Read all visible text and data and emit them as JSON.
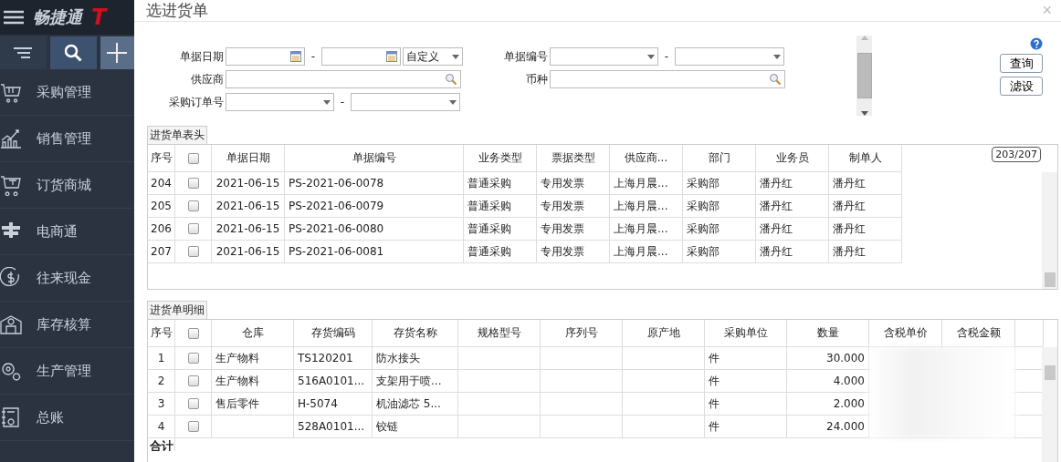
{
  "sidebar": {
    "logo": "畅捷通",
    "logo_mark": "T",
    "items": [
      {
        "label": "采购管理",
        "kind": "basket"
      },
      {
        "label": "销售管理",
        "kind": "chart"
      },
      {
        "label": "订货商城",
        "kind": "cart"
      },
      {
        "label": "电商通",
        "kind": "glyph"
      },
      {
        "label": "往来现金",
        "kind": "dollar"
      },
      {
        "label": "库存核算",
        "kind": "warehouse"
      },
      {
        "label": "生产管理",
        "kind": "gears"
      },
      {
        "label": "总账",
        "kind": "ledger"
      }
    ]
  },
  "dialog": {
    "title": "选进货单",
    "close": "×",
    "filters": {
      "date_label": "单据日期",
      "dash1": "-",
      "period": "自定义",
      "supplier_label": "供应商",
      "po_label": "采购订单号",
      "dash2": "-",
      "number_label": "单据编号",
      "dash3": "-",
      "currency_label": "币种"
    },
    "buttons": [
      "查询",
      "滤设"
    ],
    "header_table": {
      "tab": "进货单表头",
      "counter": "203/207",
      "select_all_checked": false,
      "columns": [
        "序号",
        "",
        "单据日期",
        "单据编号",
        "业务类型",
        "票据类型",
        "供应商...",
        "部门",
        "业务员",
        "制单人"
      ],
      "rows": [
        {
          "cells": [
            "204",
            "",
            "2021-06-15",
            "PS-2021-06-0078",
            "普通采购",
            "专用发票",
            "上海月晨...",
            "采购部",
            "潘丹红",
            "潘丹红"
          ],
          "checked": false
        },
        {
          "cells": [
            "205",
            "",
            "2021-06-15",
            "PS-2021-06-0079",
            "普通采购",
            "专用发票",
            "上海月晨...",
            "采购部",
            "潘丹红",
            "潘丹红"
          ],
          "checked": false
        },
        {
          "cells": [
            "206",
            "",
            "2021-06-15",
            "PS-2021-06-0080",
            "普通采购",
            "专用发票",
            "上海月晨...",
            "采购部",
            "潘丹红",
            "潘丹红"
          ],
          "checked": false
        },
        {
          "cells": [
            "207",
            "",
            "2021-06-15",
            "PS-2021-06-0081",
            "普通采购",
            "专用发票",
            "上海月晨...",
            "采购部",
            "潘丹红",
            "潘丹红"
          ],
          "checked": false
        }
      ]
    },
    "detail_table": {
      "tab": "进货单明细",
      "footer": "合计",
      "select_all_checked": false,
      "columns": [
        "序号",
        "",
        "仓库",
        "存货编码",
        "存货名称",
        "规格型号",
        "序列号",
        "原产地",
        "采购单位",
        "数量",
        "含税单价",
        "含税金额",
        ""
      ],
      "rows": [
        {
          "cells": [
            "1",
            "",
            "生产物料",
            "TS120201",
            "防水接头",
            "",
            "",
            "",
            "件",
            "30.000",
            "",
            ""
          ],
          "checked": false
        },
        {
          "cells": [
            "2",
            "",
            "生产物料",
            "516A0101...",
            "支架用于喷...",
            "",
            "",
            "",
            "件",
            "4.000",
            "",
            ""
          ],
          "checked": false
        },
        {
          "cells": [
            "3",
            "",
            "售后零件",
            "H-5074",
            "机油滤芯 5...",
            "",
            "",
            "",
            "件",
            "2.000",
            "",
            ""
          ],
          "checked": false
        },
        {
          "cells": [
            "4",
            "",
            "",
            "528A0101...",
            "铰链",
            "",
            "",
            "",
            "件",
            "24.000",
            "",
            ""
          ],
          "checked": false
        }
      ]
    }
  }
}
